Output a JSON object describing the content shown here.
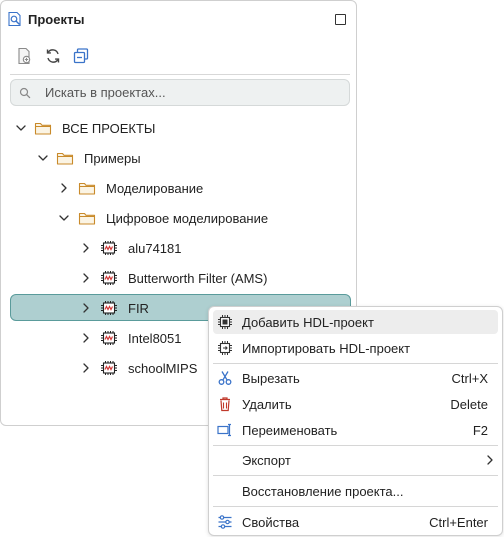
{
  "panel": {
    "title": "Проекты",
    "title_icon": "projects-search-icon",
    "toolbar": {
      "buttons": [
        {
          "name": "new-project-icon"
        },
        {
          "name": "refresh-icon"
        },
        {
          "name": "collapse-all-icon"
        }
      ]
    },
    "search": {
      "placeholder": "Искать в проектах...",
      "value": ""
    },
    "tree": [
      {
        "label": "ВСЕ ПРОЕКТЫ",
        "type": "folder",
        "expanded": true,
        "level": 0
      },
      {
        "label": "Примеры",
        "type": "folder",
        "expanded": true,
        "level": 1
      },
      {
        "label": "Моделирование",
        "type": "folder",
        "expanded": false,
        "level": 2
      },
      {
        "label": "Цифровое моделирование",
        "type": "folder",
        "expanded": true,
        "level": 2
      },
      {
        "label": "alu74181",
        "type": "chip",
        "expanded": false,
        "level": 3
      },
      {
        "label": "Butterworth Filter  (AMS)",
        "type": "chip",
        "expanded": false,
        "level": 3
      },
      {
        "label": "FIR",
        "type": "chip",
        "expanded": false,
        "level": 3,
        "selected": true
      },
      {
        "label": "Intel8051",
        "type": "chip",
        "expanded": false,
        "level": 3
      },
      {
        "label": "schoolMIPS",
        "type": "chip",
        "expanded": false,
        "level": 3
      }
    ]
  },
  "context_menu": {
    "items": [
      {
        "label": "Добавить HDL-проект",
        "icon": "chip-add-icon",
        "shortcut": ""
      },
      {
        "label": "Импортировать HDL-проект",
        "icon": "chip-import-icon",
        "shortcut": ""
      },
      {
        "label": "Вырезать",
        "icon": "scissors-icon",
        "shortcut": "Ctrl+X"
      },
      {
        "label": "Удалить",
        "icon": "trash-icon",
        "shortcut": "Delete"
      },
      {
        "label": "Переименовать",
        "icon": "rename-icon",
        "shortcut": "F2"
      },
      {
        "label": "Экспорт",
        "icon": "",
        "shortcut": "",
        "submenu": true
      },
      {
        "label": "Восстановление проекта...",
        "icon": "",
        "shortcut": ""
      },
      {
        "label": "Свойства",
        "icon": "properties-sliders-icon",
        "shortcut": "Ctrl+Enter"
      }
    ]
  },
  "colors": {
    "accent": "#3a73c9",
    "selection_bg": "#aecfd0",
    "selection_border": "#5a9b9b",
    "folder": "#d9a441",
    "chip_red": "#d23a3a",
    "danger": "#c0392b"
  }
}
